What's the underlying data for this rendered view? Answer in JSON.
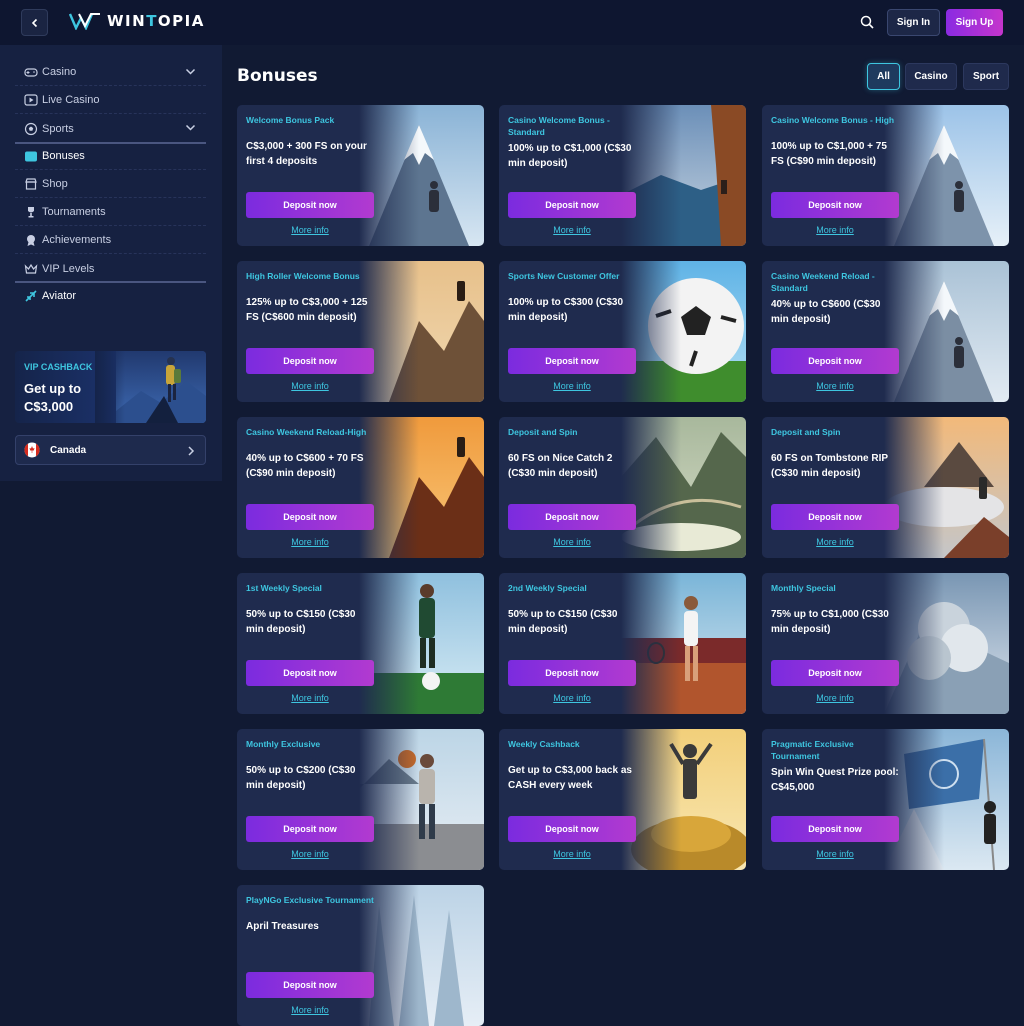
{
  "header": {
    "logo_text": "WINTOPIA",
    "signin_label": "Sign In",
    "signup_label": "Sign Up",
    "accent_color": "#3ec6e0",
    "brand_gradient": [
      "#8a2be2",
      "#c535cc"
    ]
  },
  "sidebar": {
    "items": [
      {
        "label": "Casino",
        "icon": "gamepad-icon"
      },
      {
        "label": "Live Casino",
        "icon": "live-play-icon"
      },
      {
        "label": "Sports",
        "icon": "soccer-ball-icon"
      },
      {
        "label": "Bonuses",
        "icon": "gift-icon"
      },
      {
        "label": "Shop",
        "icon": "shop-icon"
      },
      {
        "label": "Tournaments",
        "icon": "trophy-icon"
      },
      {
        "label": "Achievements",
        "icon": "medal-icon"
      },
      {
        "label": "VIP Levels",
        "icon": "crown-icon"
      },
      {
        "label": "Aviator",
        "icon": "plane-icon"
      }
    ],
    "vip": {
      "label": "VIP CASHBACK",
      "amount": "Get up to C$3,000"
    },
    "country": "Canada"
  },
  "main": {
    "title": "Bonuses",
    "filters": [
      "All",
      "Casino",
      "Sport"
    ],
    "deposit_label": "Deposit now",
    "more_label": "More info",
    "cards": [
      {
        "title": "Welcome Bonus Pack",
        "desc": "C$3,000 + 300 FS on your first 4 deposits"
      },
      {
        "title": "Casino Welcome Bonus - Standard",
        "desc": "100% up to C$1,000 (C$30 min deposit)"
      },
      {
        "title": "Casino Welcome Bonus - High",
        "desc": "100% up to C$1,000 + 75 FS (C$90 min deposit)"
      },
      {
        "title": "High Roller Welcome Bonus",
        "desc": "125% up to C$3,000 + 125 FS (C$600 min deposit)"
      },
      {
        "title": "Sports New Customer Offer",
        "desc": "100% up to C$300 (C$30 min deposit)"
      },
      {
        "title": "Casino Weekend Reload - Standard",
        "desc": "40% up to C$600 (C$30 min deposit)"
      },
      {
        "title": "Casino Weekend Reload-High",
        "desc": "40% up to C$600 + 70 FS (C$90 min deposit)"
      },
      {
        "title": "Deposit and Spin",
        "desc": "60 FS on Nice Catch 2 (C$30 min deposit)"
      },
      {
        "title": "Deposit and Spin",
        "desc": "60 FS on Tombstone RIP (C$30 min deposit)"
      },
      {
        "title": "1st Weekly Special",
        "desc": "50% up to C$150 (C$30 min deposit)"
      },
      {
        "title": "2nd Weekly Special",
        "desc": "50% up to C$150 (C$30 min deposit)"
      },
      {
        "title": "Monthly Special",
        "desc": "75% up to C$1,000 (C$30 min deposit)"
      },
      {
        "title": "Monthly Exclusive",
        "desc": "50% up to C$200 (C$30 min deposit)"
      },
      {
        "title": "Weekly Cashback",
        "desc": "Get up to C$3,000 back as CASH every week"
      },
      {
        "title": "Pragmatic Exclusive Tournament",
        "desc": "Spin Win Quest Prize pool: C$45,000"
      },
      {
        "title": "PlayNGo Exclusive Tournament",
        "desc": "April Treasures"
      }
    ]
  }
}
